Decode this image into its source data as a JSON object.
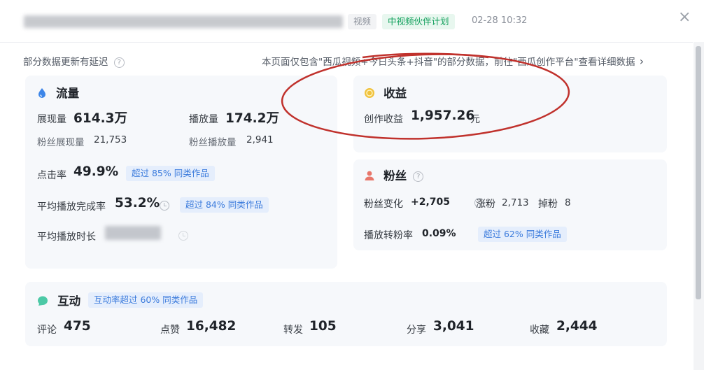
{
  "header": {
    "tag_type": "视频",
    "tag_program": "中视频伙伴计划",
    "time": "02-28 10:32",
    "close": "×"
  },
  "notice": {
    "delay_text": "部分数据更新有延迟",
    "help": "?",
    "scope_text": "本页面仅包含\"西瓜视频+今日头条+抖音\"的部分数据，前往\"西瓜创作平台\"查看详细数据",
    "scope_arrow": "›"
  },
  "traffic": {
    "title": "流量",
    "impressions_label": "展现量",
    "impressions_value": "614.3万",
    "plays_label": "播放量",
    "plays_value": "174.2万",
    "fan_impressions_label": "粉丝展现量",
    "fan_impressions_value": "21,753",
    "fan_plays_label": "粉丝播放量",
    "fan_plays_value": "2,941",
    "ctr_label": "点击率",
    "ctr_value": "49.9%",
    "ctr_badge": "超过 85% 同类作品",
    "completion_label": "平均播放完成率",
    "completion_value": "53.2%",
    "completion_badge": "超过 84% 同类作品",
    "duration_label": "平均播放时长"
  },
  "revenue": {
    "title": "收益",
    "creation_label": "创作收益",
    "creation_value": "1,957.26",
    "unit": "元"
  },
  "fans": {
    "title": "粉丝",
    "help": "?",
    "change_label": "粉丝变化",
    "change_value": "+2,705",
    "gain_label": "涨粉",
    "gain_value": "2,713",
    "loss_label": "掉粉",
    "loss_value": "8",
    "conv_label": "播放转粉率",
    "conv_value": "0.09%",
    "conv_badge": "超过 62% 同类作品"
  },
  "interaction": {
    "title": "互动",
    "badge": "互动率超过 60% 同类作品",
    "comments_label": "评论",
    "comments_value": "475",
    "likes_label": "点赞",
    "likes_value": "16,482",
    "shares_label": "转发",
    "shares_value": "105",
    "share_out_label": "分享",
    "share_out_value": "3,041",
    "favorites_label": "收藏",
    "favorites_value": "2,444"
  },
  "colors": {
    "traffic_icon": "#3d86e8",
    "revenue_icon": "#f0c23c",
    "fans_icon": "#e8766a",
    "interaction_icon": "#4cc9a6",
    "annotation": "#c0312c"
  },
  "icons": {
    "traffic": "water-drop-icon",
    "revenue": "coin-icon",
    "fans": "person-icon",
    "interaction": "chat-bubble-icon"
  }
}
